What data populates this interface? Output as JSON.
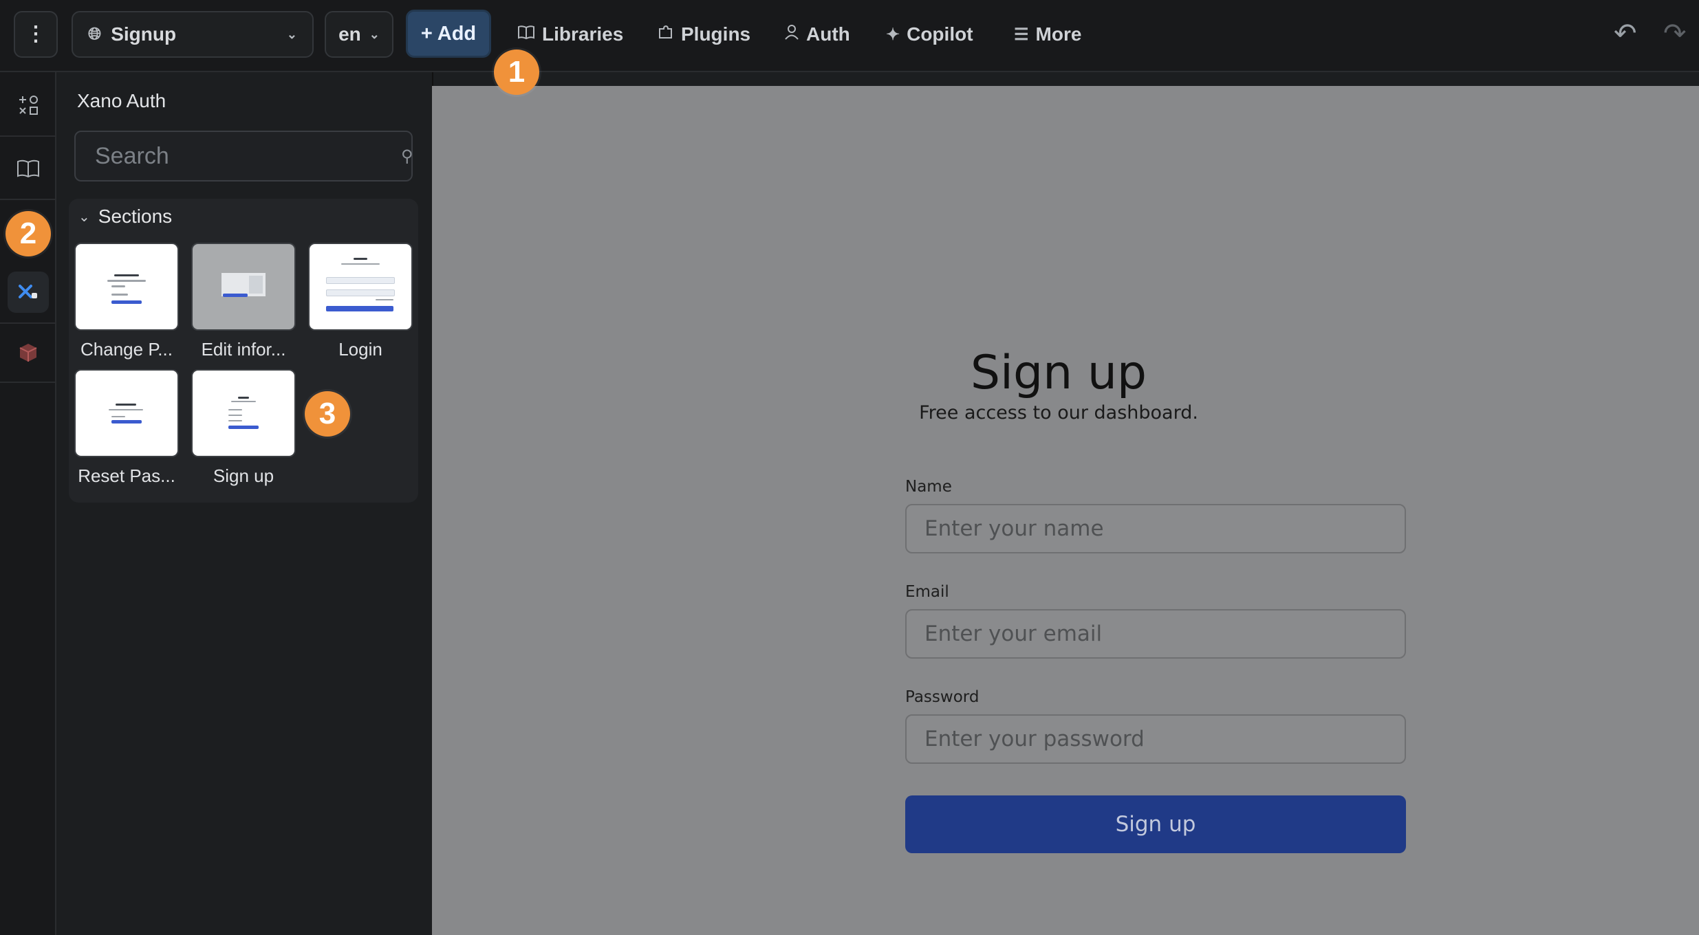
{
  "topbar": {
    "page_name": "Signup",
    "language": "en",
    "add_label": "+ Add",
    "nav": [
      {
        "label": "Libraries",
        "icon": "book-icon"
      },
      {
        "label": "Plugins",
        "icon": "puzzle-icon"
      },
      {
        "label": "Auth",
        "icon": "user-icon"
      },
      {
        "label": "Copilot",
        "icon": "sparkle-icon"
      },
      {
        "label": "More",
        "icon": "hamburger-icon"
      }
    ]
  },
  "rail": {
    "icons": [
      "components-icon",
      "book-icon",
      "xano-icon",
      "cube-icon"
    ],
    "active": "xano-icon"
  },
  "panel": {
    "title": "Xano Auth",
    "search_placeholder": "Search",
    "sections_label": "Sections",
    "tiles": [
      {
        "label": "Change P..."
      },
      {
        "label": "Edit infor..."
      },
      {
        "label": "Login"
      },
      {
        "label": "Reset Pas..."
      },
      {
        "label": "Sign up"
      }
    ]
  },
  "canvas": {
    "title": "Sign up",
    "subtitle": "Free access to our dashboard.",
    "fields": [
      {
        "label": "Name",
        "placeholder": "Enter your name"
      },
      {
        "label": "Email",
        "placeholder": "Enter your email"
      },
      {
        "label": "Password",
        "placeholder": "Enter your password"
      }
    ],
    "submit_label": "Sign up"
  },
  "badges": [
    "1",
    "2",
    "3"
  ],
  "colors": {
    "badge": "#f0923a",
    "add_button": "#2b4666",
    "submit_button": "#203a87",
    "canvas_bg": "#88898b"
  }
}
